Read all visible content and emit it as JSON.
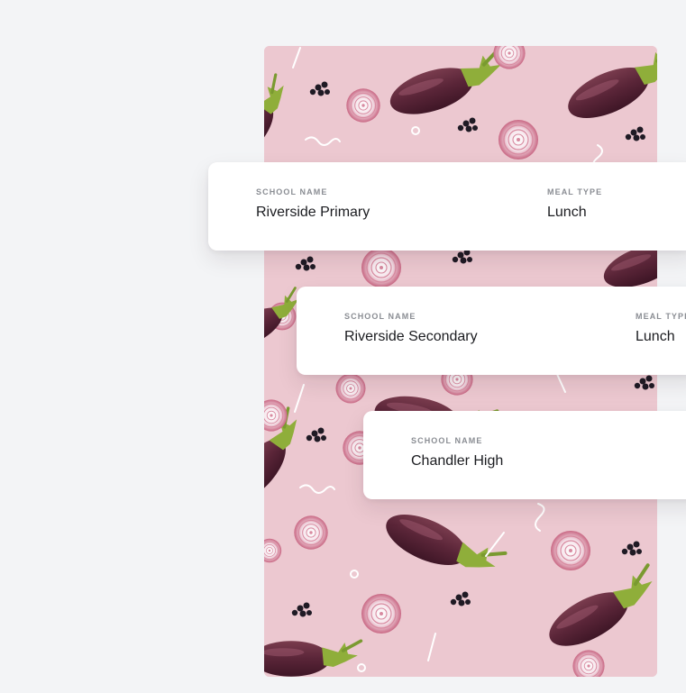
{
  "background": {
    "page_color": "#f3f4f6",
    "photo_color": "#ecc8d0",
    "photo_description_icons": [
      "eggplant-icon",
      "onion-slice-icon",
      "peppercorn-icon",
      "squiggle-icon",
      "ring-icon",
      "stroke-icon"
    ]
  },
  "cards": [
    {
      "school_label": "SCHOOL NAME",
      "school_value": "Riverside Primary",
      "meal_label": "MEAL TYPE",
      "meal_value": "Lunch"
    },
    {
      "school_label": "SCHOOL NAME",
      "school_value": "Riverside Secondary",
      "meal_label": "MEAL TYPE",
      "meal_value": "Lunch"
    },
    {
      "school_label": "SCHOOL NAME",
      "school_value": "Chandler High"
    }
  ]
}
